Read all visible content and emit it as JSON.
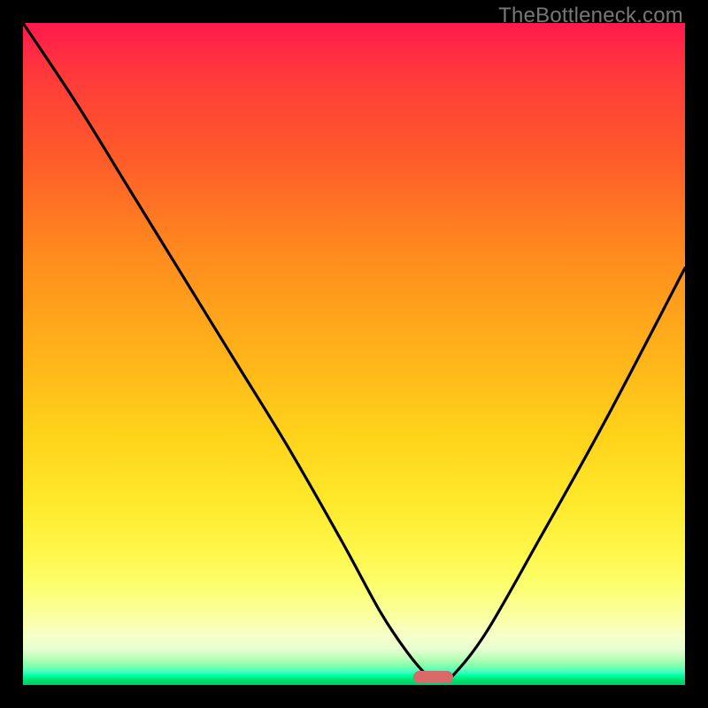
{
  "watermark": "TheBottleneck.com",
  "colors": {
    "frame": "#000000",
    "curve_stroke": "#000000",
    "marker_fill": "#d96a6a",
    "gradient_top": "#ff1a4d",
    "gradient_mid": "#ffd21a",
    "gradient_green": "#00cc66"
  },
  "chart_data": {
    "type": "line",
    "title": "",
    "xlabel": "",
    "ylabel": "",
    "xlim": [
      0,
      100
    ],
    "ylim": [
      0,
      100
    ],
    "grid": false,
    "legend": false,
    "series": [
      {
        "name": "bottleneck-curve",
        "x": [
          0,
          8,
          16,
          24,
          32,
          40,
          48,
          54,
          58,
          61,
          63,
          65,
          70,
          78,
          88,
          100
        ],
        "y": [
          100,
          88,
          75,
          62,
          49,
          36,
          22,
          11,
          5,
          1.5,
          0.5,
          1.5,
          8,
          22,
          40,
          63
        ]
      }
    ],
    "annotations": [
      {
        "name": "optimal-marker",
        "shape": "pill",
        "x": 62,
        "y": 1.2,
        "width_pct": 6,
        "color": "#d96a6a"
      }
    ]
  }
}
